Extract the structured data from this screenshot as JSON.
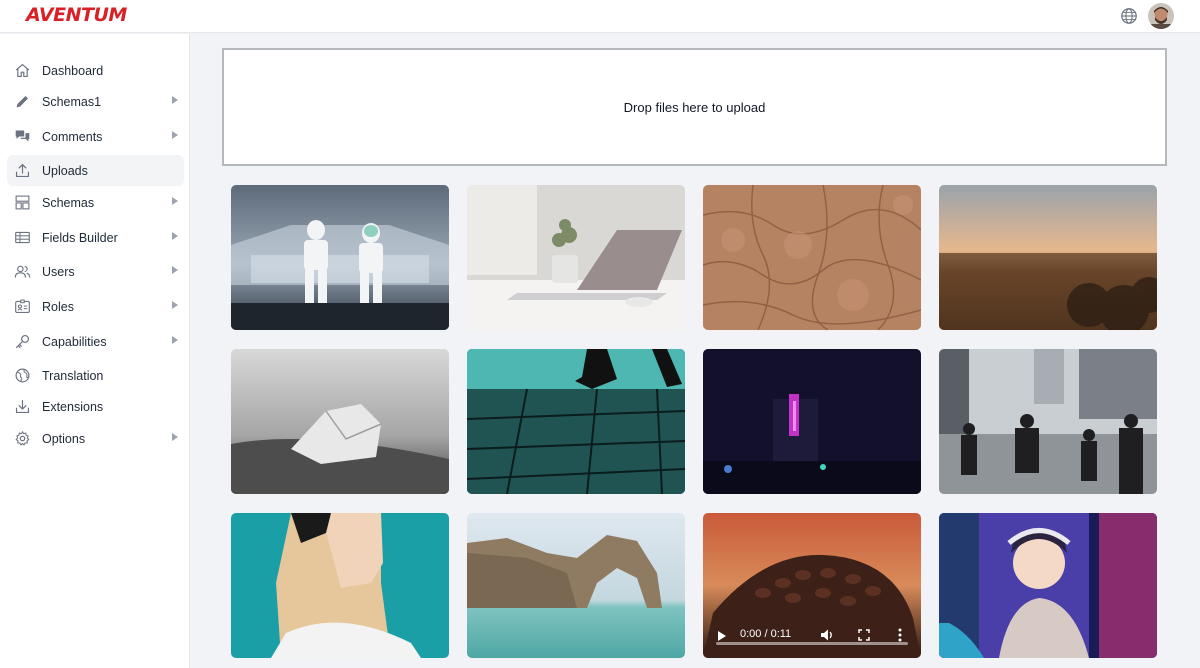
{
  "app": {
    "logo_text": "AVENTUM"
  },
  "header": {
    "language_icon": "globe-icon",
    "avatar": "user-avatar"
  },
  "sidebar": {
    "items": [
      {
        "label": "Dashboard",
        "icon": "home-icon",
        "submenu": false,
        "active": false
      },
      {
        "label": "Schemas1",
        "icon": "pencil-icon",
        "submenu": true,
        "active": false
      },
      {
        "label": "Comments",
        "icon": "comments-icon",
        "submenu": true,
        "active": false
      },
      {
        "label": "Uploads",
        "icon": "upload-icon",
        "submenu": false,
        "active": true
      },
      {
        "label": "Schemas",
        "icon": "layout-icon",
        "submenu": true,
        "active": false
      },
      {
        "label": "Fields Builder",
        "icon": "table-icon",
        "submenu": true,
        "active": false
      },
      {
        "label": "Users",
        "icon": "users-icon",
        "submenu": true,
        "active": false
      },
      {
        "label": "Roles",
        "icon": "id-card-icon",
        "submenu": true,
        "active": false
      },
      {
        "label": "Capabilities",
        "icon": "key-icon",
        "submenu": true,
        "active": false
      },
      {
        "label": "Translation",
        "icon": "globe-icon",
        "submenu": false,
        "active": false
      },
      {
        "label": "Extensions",
        "icon": "download-icon",
        "submenu": false,
        "active": false
      },
      {
        "label": "Options",
        "icon": "gear-icon",
        "submenu": true,
        "active": false
      }
    ]
  },
  "upload": {
    "dropzone_text": "Drop files here to upload"
  },
  "gallery": {
    "items": [
      {
        "name": "stormtroopers-image",
        "kind": "image"
      },
      {
        "name": "laptop-desk-image",
        "kind": "image"
      },
      {
        "name": "cracked-earth-image",
        "kind": "image"
      },
      {
        "name": "city-sunset-image",
        "kind": "image"
      },
      {
        "name": "ice-beach-image",
        "kind": "image"
      },
      {
        "name": "teal-walker-image",
        "kind": "image"
      },
      {
        "name": "neon-night-image",
        "kind": "image"
      },
      {
        "name": "street-crossing-image",
        "kind": "image"
      },
      {
        "name": "blonde-portrait-image",
        "kind": "image"
      },
      {
        "name": "rock-arch-image",
        "kind": "image"
      },
      {
        "name": "coffee-beans-video",
        "kind": "video",
        "time": "0:00 / 0:11"
      },
      {
        "name": "neon-portrait-image",
        "kind": "image"
      }
    ]
  },
  "colors": {
    "brand": "#d92027",
    "active_nav": "#f3f4f6",
    "background": "#f1f3f6"
  }
}
